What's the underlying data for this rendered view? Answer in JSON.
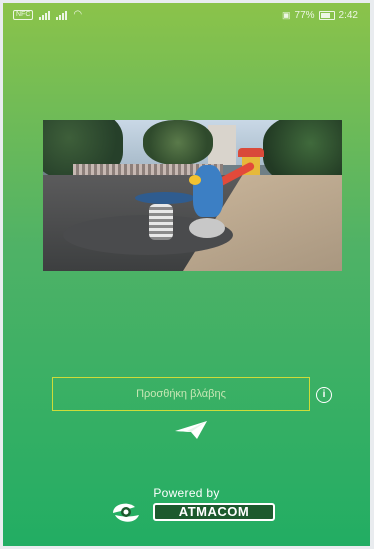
{
  "status_bar": {
    "nfc_label": "NFC",
    "battery_percent": "77%",
    "time": "2:42"
  },
  "photo": {
    "subject": "playground spring rider with slide"
  },
  "damage_form": {
    "input_placeholder": "Προσθήκη βλάβης",
    "input_value": "",
    "info_icon": "info-icon",
    "send_icon": "send-icon"
  },
  "footer": {
    "powered_by": "Powered by",
    "brand": "ATMACOM"
  },
  "colors": {
    "gradient_top": "#8bc34a",
    "gradient_bottom": "#22ad63",
    "input_border": "#cddc39",
    "brand_dark": "#1d5a2e"
  }
}
